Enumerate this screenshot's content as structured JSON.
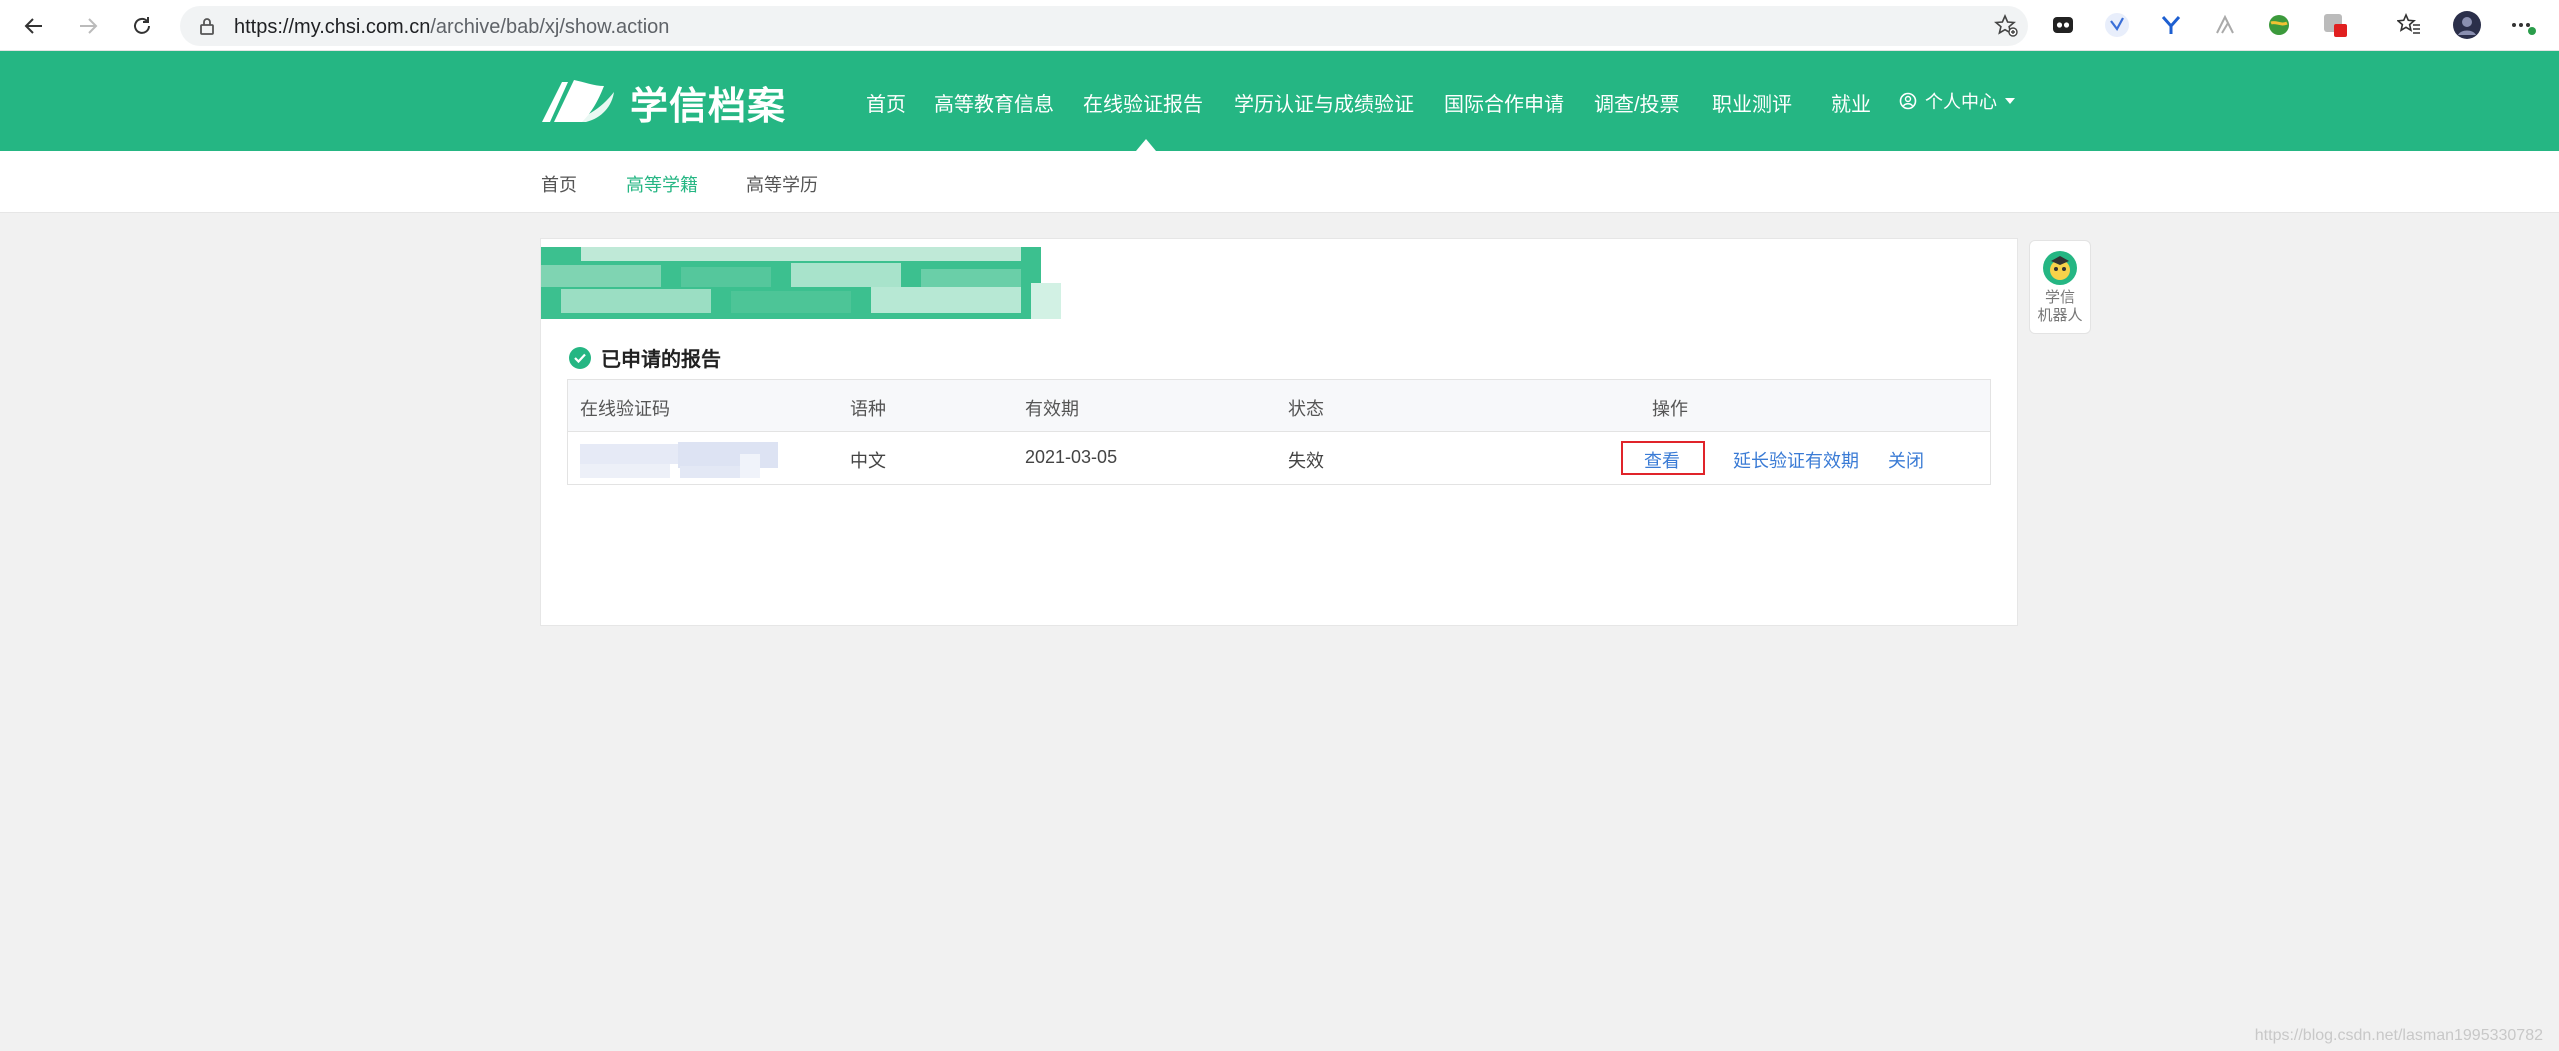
{
  "browser": {
    "url_domain": "https://my.chsi.com.cn",
    "url_path": "/archive/bab/xj/show.action"
  },
  "site": {
    "logo_text": "学信档案",
    "nav": [
      "首页",
      "高等教育信息",
      "在线验证报告",
      "学历认证与成绩验证",
      "国际合作申请",
      "调查/投票",
      "职业测评",
      "就业",
      "个人中心"
    ],
    "active_nav": "在线验证报告"
  },
  "subnav": {
    "items": [
      "首页",
      "高等学籍",
      "高等学历"
    ],
    "active": "高等学籍"
  },
  "section": {
    "title": "已申请的报告"
  },
  "table": {
    "headers": [
      "在线验证码",
      "语种",
      "有效期",
      "状态",
      "操作"
    ],
    "rows": [
      {
        "code": "",
        "language": "中文",
        "expiry": "2021-03-05",
        "status": "失效",
        "actions": [
          "查看",
          "延长验证有效期",
          "关闭"
        ]
      }
    ]
  },
  "robot": {
    "line1": "学信",
    "line2": "机器人"
  },
  "watermark": "https://blog.csdn.net/lasman1995330782",
  "colors": {
    "brand_green": "#25b683",
    "link_blue": "#3a7bd5",
    "highlight_red": "#e0242a"
  }
}
